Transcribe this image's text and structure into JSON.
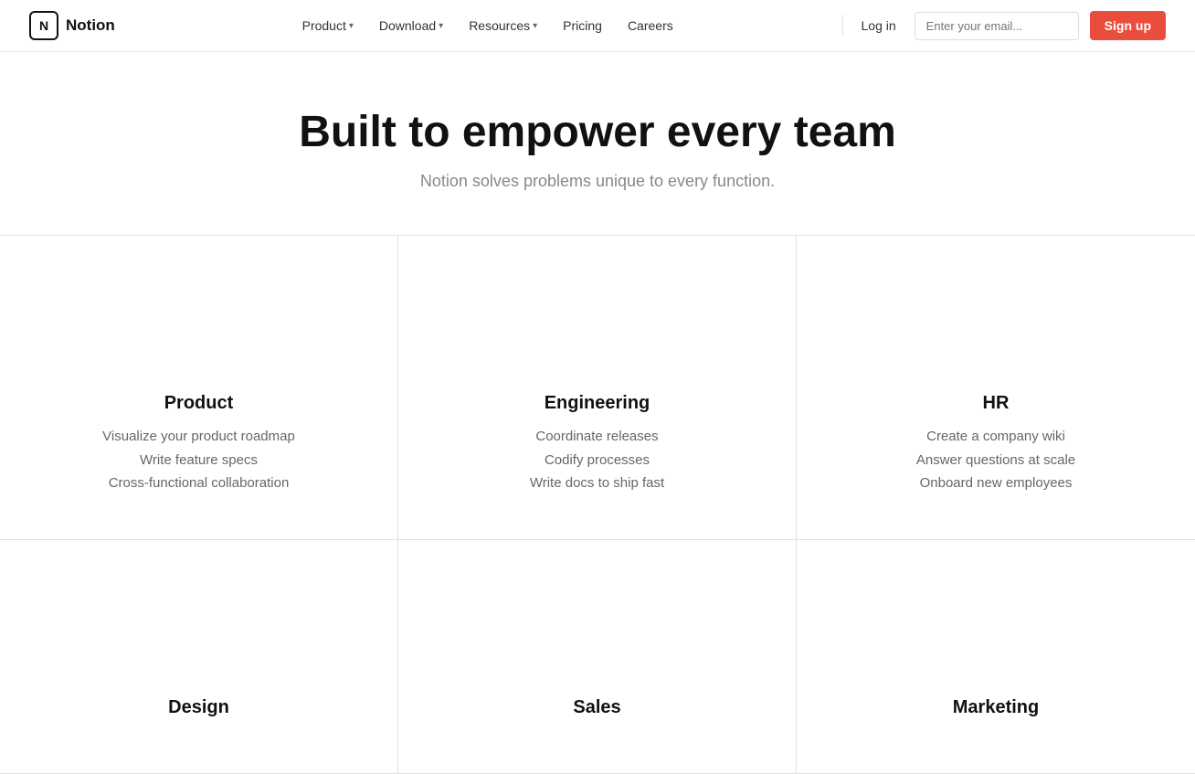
{
  "nav": {
    "logo_text": "Notion",
    "links": [
      {
        "label": "Product",
        "has_dropdown": true
      },
      {
        "label": "Download",
        "has_dropdown": true
      },
      {
        "label": "Resources",
        "has_dropdown": true
      },
      {
        "label": "Pricing",
        "has_dropdown": false
      },
      {
        "label": "Careers",
        "has_dropdown": false
      }
    ],
    "login_label": "Log in",
    "email_placeholder": "Enter your email...",
    "signup_label": "Sign up"
  },
  "hero": {
    "title": "Built to empower every team",
    "subtitle": "Notion solves problems unique to every function."
  },
  "features": [
    {
      "id": "product",
      "title": "Product",
      "desc_lines": [
        "Visualize your product roadmap",
        "Write feature specs",
        "Cross-functional collaboration"
      ]
    },
    {
      "id": "engineering",
      "title": "Engineering",
      "desc_lines": [
        "Coordinate releases",
        "Codify processes",
        "Write docs to ship fast"
      ]
    },
    {
      "id": "hr",
      "title": "HR",
      "desc_lines": [
        "Create a company wiki",
        "Answer questions at scale",
        "Onboard new employees"
      ]
    },
    {
      "id": "design",
      "title": "Design",
      "desc_lines": []
    },
    {
      "id": "sales",
      "title": "Sales",
      "desc_lines": []
    },
    {
      "id": "marketing",
      "title": "Marketing",
      "desc_lines": []
    }
  ]
}
